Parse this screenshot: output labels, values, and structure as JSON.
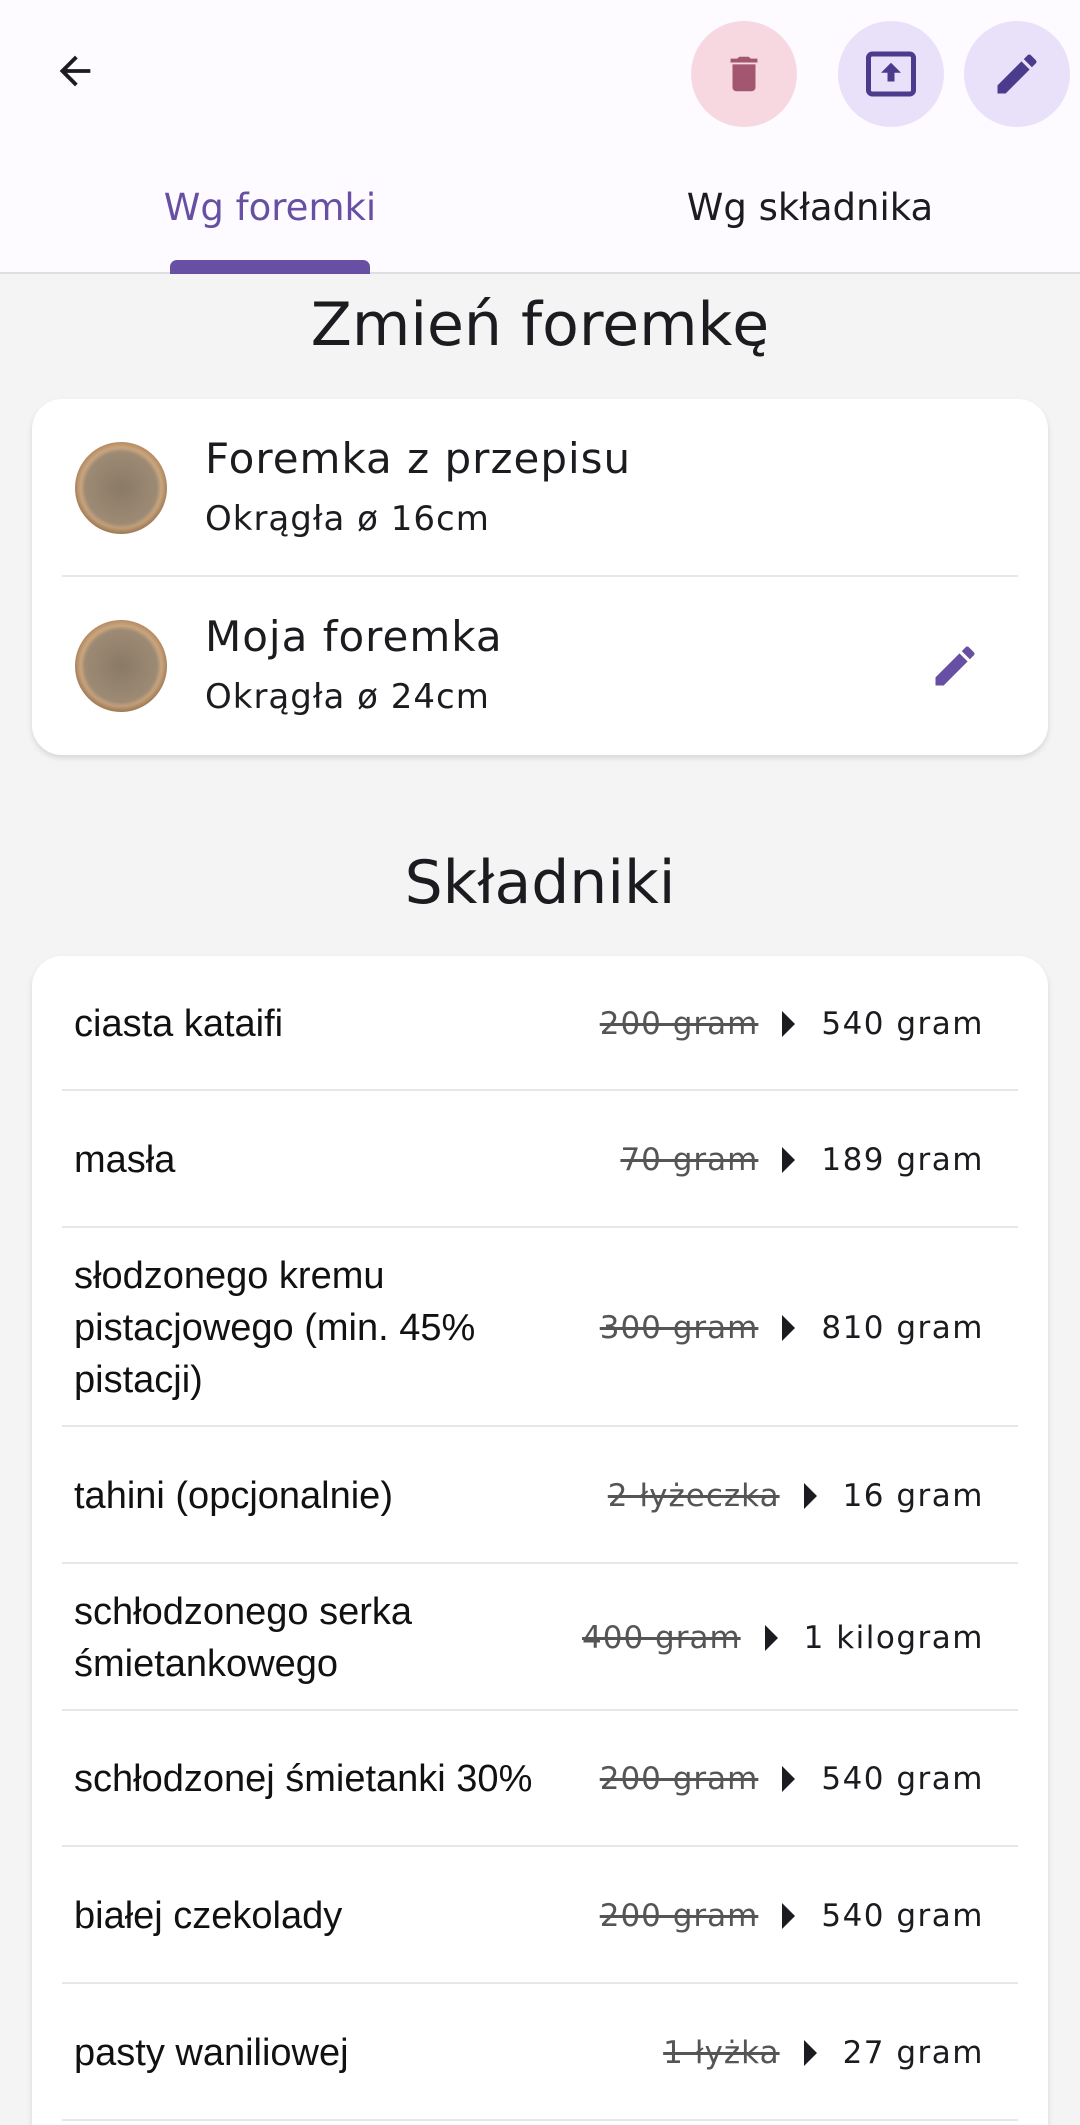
{
  "toolbar": {
    "back_icon": "arrow-back-icon",
    "delete_icon": "trash-icon",
    "share_icon": "upload-screen-icon",
    "edit_icon": "pencil-icon"
  },
  "colors": {
    "primary": "#6750a4",
    "delete_bg": "#f7d8e1",
    "delete_icon": "#a3566f",
    "action_bg": "#e9e1f9"
  },
  "tabs": [
    {
      "label": "Wg foremki",
      "selected": true
    },
    {
      "label": "Wg składnika",
      "selected": false
    }
  ],
  "molds_section": {
    "title": "Zmień foremkę",
    "items": [
      {
        "name": "Foremka z przepisu",
        "size": "Okrągła ø 16cm"
      },
      {
        "name": "Moja foremka",
        "size": "Okrągła ø 24cm"
      }
    ]
  },
  "ingredients_section": {
    "title": "Składniki",
    "items": [
      {
        "name": "ciasta kataifi",
        "old": "200 gram",
        "new": "540 gram"
      },
      {
        "name": "masła",
        "old": "70 gram",
        "new": "189 gram"
      },
      {
        "name": "słodzonego kremu pistacjowego (min. 45% pistacji)",
        "old": "300 gram",
        "new": "810 gram"
      },
      {
        "name": "tahini (opcjonalnie)",
        "old": "2 łyżeczka",
        "new": "16 gram"
      },
      {
        "name": "schłodzonego serka śmietankowego",
        "old": "400 gram",
        "new": "1 kilogram"
      },
      {
        "name": "schłodzonej śmietanki 30%",
        "old": "200 gram",
        "new": "540 gram"
      },
      {
        "name": "białej czekolady",
        "old": "200 gram",
        "new": "540 gram"
      },
      {
        "name": "pasty waniliowej",
        "old": "1 łyżka",
        "new": "27 gram"
      }
    ]
  }
}
